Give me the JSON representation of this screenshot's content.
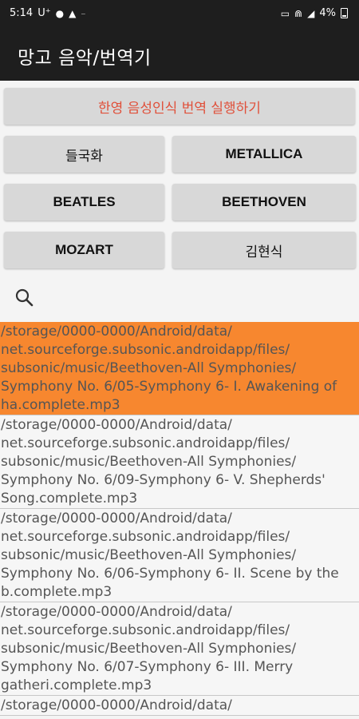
{
  "status": {
    "time": "5:14",
    "carrier": "U⁺",
    "battery": "4%"
  },
  "appbar": {
    "title": "망고 음악/번역기"
  },
  "buttons": {
    "translate": "한영 음성인식 번역 실행하기",
    "b1": "들국화",
    "b2": "METALLICA",
    "b3": "BEATLES",
    "b4": "BEETHOVEN",
    "b5": "MOZART",
    "b6": "김현식"
  },
  "files": [
    {
      "l1": "/storage/0000-0000/Android/data/",
      "l2": "net.sourceforge.subsonic.androidapp/files/",
      "l3": "subsonic/music/Beethoven-All Symphonies/",
      "l4": "Symphony No. 6/05-Symphony 6- I. Awakening of",
      "l5": "ha.complete.mp3"
    },
    {
      "l1": "/storage/0000-0000/Android/data/",
      "l2": "net.sourceforge.subsonic.androidapp/files/",
      "l3": "subsonic/music/Beethoven-All Symphonies/",
      "l4": "Symphony No. 6/09-Symphony 6- V. Shepherds'",
      "l5": "Song.complete.mp3"
    },
    {
      "l1": "/storage/0000-0000/Android/data/",
      "l2": "net.sourceforge.subsonic.androidapp/files/",
      "l3": "subsonic/music/Beethoven-All Symphonies/",
      "l4": "Symphony No. 6/06-Symphony 6- II. Scene by the",
      "l5": "b.complete.mp3"
    },
    {
      "l1": "/storage/0000-0000/Android/data/",
      "l2": "net.sourceforge.subsonic.androidapp/files/",
      "l3": "subsonic/music/Beethoven-All Symphonies/",
      "l4": "Symphony No. 6/07-Symphony 6- III. Merry",
      "l5": "gatheri.complete.mp3"
    },
    {
      "l1": "/storage/0000-0000/Android/data/"
    }
  ]
}
